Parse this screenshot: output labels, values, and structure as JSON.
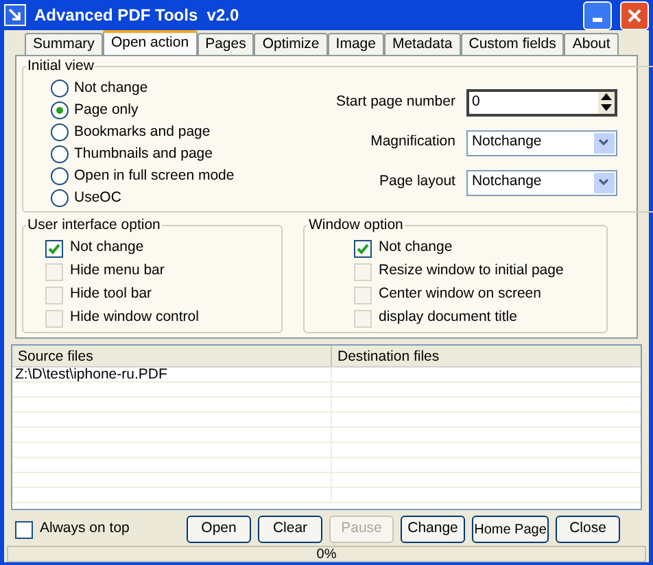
{
  "window": {
    "title": "Advanced PDF Tools  v2.0"
  },
  "tabs": [
    {
      "label": "Summary",
      "selected": false
    },
    {
      "label": "Open action",
      "selected": true
    },
    {
      "label": "Pages",
      "selected": false
    },
    {
      "label": "Optimize",
      "selected": false
    },
    {
      "label": "Image",
      "selected": false
    },
    {
      "label": "Metadata",
      "selected": false
    },
    {
      "label": "Custom fields",
      "selected": false
    },
    {
      "label": "About",
      "selected": false
    }
  ],
  "initial_view": {
    "title": "Initial view",
    "options": [
      {
        "label": "Not change",
        "selected": false
      },
      {
        "label": "Page only",
        "selected": true
      },
      {
        "label": "Bookmarks and page",
        "selected": false
      },
      {
        "label": "Thumbnails and page",
        "selected": false
      },
      {
        "label": "Open in full screen mode",
        "selected": false
      },
      {
        "label": "UseOC",
        "selected": false
      }
    ],
    "start_page": {
      "label": "Start page number",
      "value": "0"
    },
    "magnification": {
      "label": "Magnification",
      "value": "Notchange"
    },
    "page_layout": {
      "label": "Page layout",
      "value": "Notchange"
    }
  },
  "user_interface_option": {
    "title": "User interface option",
    "options": [
      {
        "label": "Not change",
        "checked": true
      },
      {
        "label": "Hide menu bar",
        "checked": false
      },
      {
        "label": "Hide tool bar",
        "checked": false
      },
      {
        "label": "Hide window control",
        "checked": false
      }
    ]
  },
  "window_option": {
    "title": "Window option",
    "options": [
      {
        "label": "Not change",
        "checked": true
      },
      {
        "label": "Resize window to initial page",
        "checked": false
      },
      {
        "label": "Center window on screen",
        "checked": false
      },
      {
        "label": "display document title",
        "checked": false
      }
    ]
  },
  "file_table": {
    "columns": [
      "Source files",
      "Destination files"
    ],
    "rows": [
      {
        "source": "Z:\\D\\test\\iphone-ru.PDF"
      }
    ]
  },
  "always_on_top": {
    "label": "Always on top",
    "checked": false
  },
  "buttons": [
    {
      "label": "Open",
      "disabled": false
    },
    {
      "label": "Clear",
      "disabled": false
    },
    {
      "label": "Pause",
      "disabled": true
    },
    {
      "label": "Change",
      "disabled": false
    },
    {
      "label": "Home Page",
      "disabled": false
    },
    {
      "label": "Close",
      "disabled": false
    }
  ],
  "status_bar": {
    "text": "0%"
  }
}
